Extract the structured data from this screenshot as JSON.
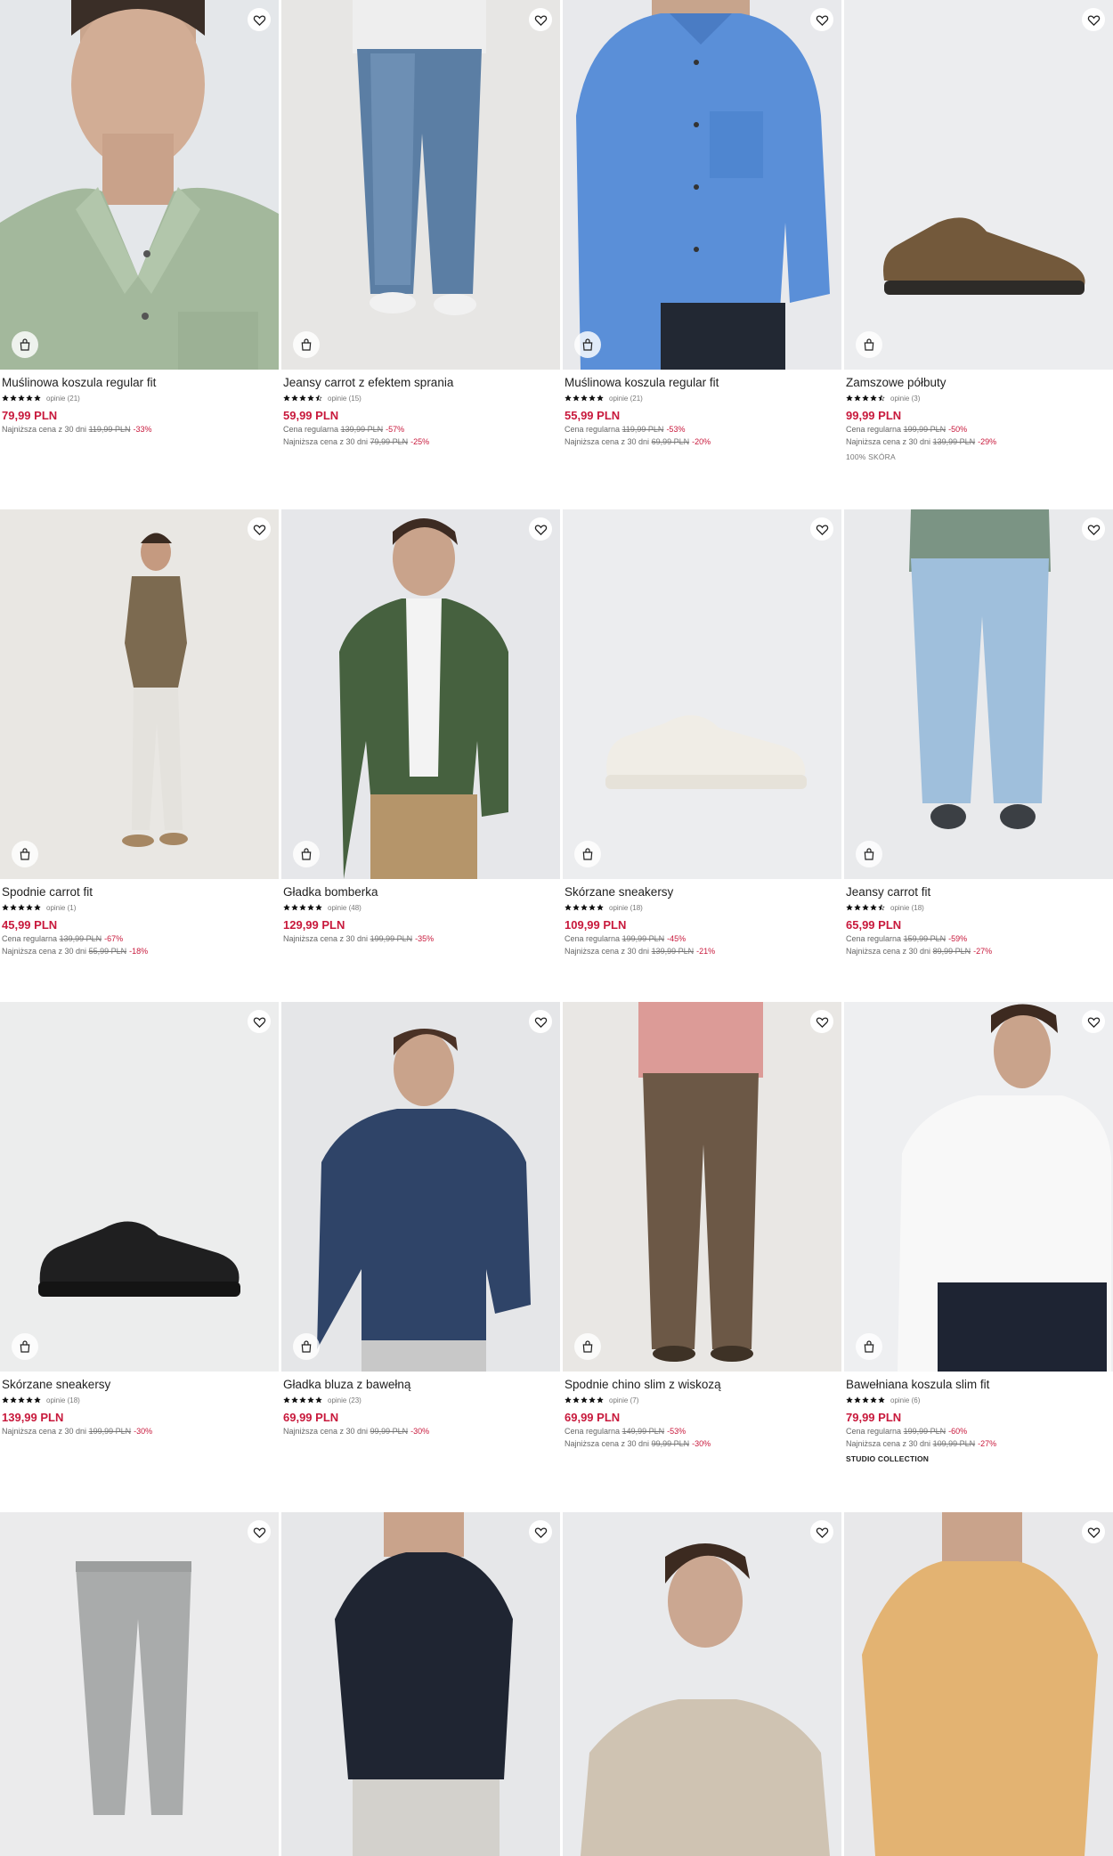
{
  "icons": {
    "wishlist": "heart-icon",
    "add_to_bag": "shopping-bag-icon",
    "rating": "star-icon"
  },
  "colors": {
    "price": "#c8193c",
    "discount": "#c8193c",
    "text": "#222222",
    "muted": "#666666"
  },
  "products": [
    {
      "name": "Muślinowa koszula regular fit",
      "stars": 5.0,
      "reviews": "opinie (21)",
      "price": "79,99 PLN",
      "lowest_label": "Najniższa cena z 30 dni",
      "lowest_old": "119,99 PLN",
      "lowest_disc": "-33%"
    },
    {
      "name": "Jeansy carrot z efektem sprania",
      "stars": 4.5,
      "reviews": "opinie (15)",
      "price": "59,99 PLN",
      "regular_label": "Cena regularna",
      "regular_old": "139,99 PLN",
      "regular_disc": "-57%",
      "lowest_label": "Najniższa cena z 30 dni",
      "lowest_old": "79,99 PLN",
      "lowest_disc": "-25%"
    },
    {
      "name": "Muślinowa koszula regular fit",
      "stars": 5.0,
      "reviews": "opinie (21)",
      "price": "55,99 PLN",
      "regular_label": "Cena regularna",
      "regular_old": "119,99 PLN",
      "regular_disc": "-53%",
      "lowest_label": "Najniższa cena z 30 dni",
      "lowest_old": "69,99 PLN",
      "lowest_disc": "-20%"
    },
    {
      "name": "Zamszowe półbuty",
      "stars": 4.5,
      "reviews": "opinie (3)",
      "price": "99,99 PLN",
      "regular_label": "Cena regularna",
      "regular_old": "199,99 PLN",
      "regular_disc": "-50%",
      "lowest_label": "Najniższa cena z 30 dni",
      "lowest_old": "139,99 PLN",
      "lowest_disc": "-29%",
      "tag": "100% SKÓRA"
    },
    {
      "name": "Spodnie carrot fit",
      "stars": 5.0,
      "reviews": "opinie (1)",
      "price": "45,99 PLN",
      "regular_label": "Cena regularna",
      "regular_old": "139,99 PLN",
      "regular_disc": "-67%",
      "lowest_label": "Najniższa cena z 30 dni",
      "lowest_old": "55,99 PLN",
      "lowest_disc": "-18%"
    },
    {
      "name": "Gładka bomberka",
      "stars": 5.0,
      "reviews": "opinie (48)",
      "price": "129,99 PLN",
      "lowest_label": "Najniższa cena z 30 dni",
      "lowest_old": "199,99 PLN",
      "lowest_disc": "-35%"
    },
    {
      "name": "Skórzane sneakersy",
      "stars": 5.0,
      "reviews": "opinie (18)",
      "price": "109,99 PLN",
      "regular_label": "Cena regularna",
      "regular_old": "199,99 PLN",
      "regular_disc": "-45%",
      "lowest_label": "Najniższa cena z 30 dni",
      "lowest_old": "139,99 PLN",
      "lowest_disc": "-21%"
    },
    {
      "name": "Jeansy carrot fit",
      "stars": 4.5,
      "reviews": "opinie (18)",
      "price": "65,99 PLN",
      "regular_label": "Cena regularna",
      "regular_old": "159,99 PLN",
      "regular_disc": "-59%",
      "lowest_label": "Najniższa cena z 30 dni",
      "lowest_old": "89,99 PLN",
      "lowest_disc": "-27%"
    },
    {
      "name": "Skórzane sneakersy",
      "stars": 5.0,
      "reviews": "opinie (18)",
      "price": "139,99 PLN",
      "lowest_label": "Najniższa cena z 30 dni",
      "lowest_old": "199,99 PLN",
      "lowest_disc": "-30%"
    },
    {
      "name": "Gładka bluza z bawełną",
      "stars": 5.0,
      "reviews": "opinie (23)",
      "price": "69,99 PLN",
      "lowest_label": "Najniższa cena z 30 dni",
      "lowest_old": "99,99 PLN",
      "lowest_disc": "-30%"
    },
    {
      "name": "Spodnie chino slim z wiskozą",
      "stars": 5.0,
      "reviews": "opinie (7)",
      "price": "69,99 PLN",
      "regular_label": "Cena regularna",
      "regular_old": "149,99 PLN",
      "regular_disc": "-53%",
      "lowest_label": "Najniższa cena z 30 dni",
      "lowest_old": "99,99 PLN",
      "lowest_disc": "-30%"
    },
    {
      "name": "Bawełniana koszula slim fit",
      "stars": 5.0,
      "reviews": "opinie (6)",
      "price": "79,99 PLN",
      "regular_label": "Cena regularna",
      "regular_old": "199,99 PLN",
      "regular_disc": "-60%",
      "lowest_label": "Najniższa cena z 30 dni",
      "lowest_old": "109,99 PLN",
      "lowest_disc": "-27%",
      "tag": "STUDIO COLLECTION"
    },
    {
      "name": "",
      "stars": 0,
      "reviews": "",
      "price": ""
    },
    {
      "name": "",
      "stars": 0,
      "reviews": "",
      "price": ""
    },
    {
      "name": "",
      "stars": 0,
      "reviews": "",
      "price": ""
    },
    {
      "name": "",
      "stars": 0,
      "reviews": "",
      "price": ""
    }
  ]
}
